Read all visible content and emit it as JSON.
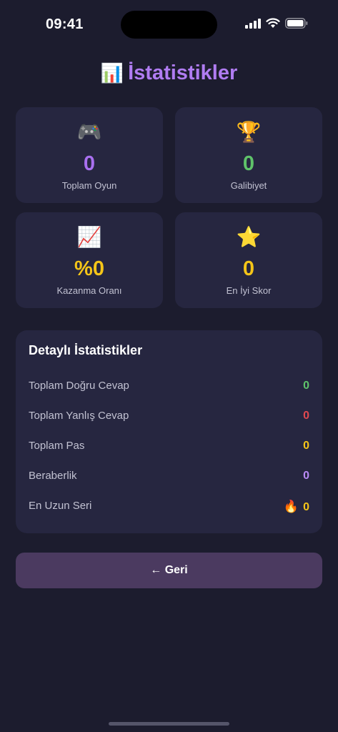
{
  "status": {
    "time": "09:41"
  },
  "header": {
    "icon": "📊",
    "title": "İstatistikler"
  },
  "cards": [
    {
      "icon": "🎮",
      "value": "0",
      "label": "Toplam Oyun",
      "color": "#a970f0"
    },
    {
      "icon": "🏆",
      "value": "0",
      "label": "Galibiyet",
      "color": "#5fc36a"
    },
    {
      "icon": "📈",
      "value": "%0",
      "label": "Kazanma Oranı",
      "color": "#f5c518"
    },
    {
      "icon": "⭐",
      "value": "0",
      "label": "En İyi Skor",
      "color": "#f5c518"
    }
  ],
  "details": {
    "title": "Detaylı İstatistikler",
    "rows": [
      {
        "label": "Toplam Doğru Cevap",
        "value": "0",
        "color": "#5fc36a"
      },
      {
        "label": "Toplam Yanlış Cevap",
        "value": "0",
        "color": "#e0484f"
      },
      {
        "label": "Toplam Pas",
        "value": "0",
        "color": "#f5c518"
      },
      {
        "label": "Beraberlik",
        "value": "0",
        "color": "#b98af5"
      },
      {
        "label": "En Uzun Seri",
        "icon": "🔥",
        "value": "0",
        "color": "#f5c518"
      }
    ]
  },
  "back_button": {
    "label": "← Geri"
  }
}
